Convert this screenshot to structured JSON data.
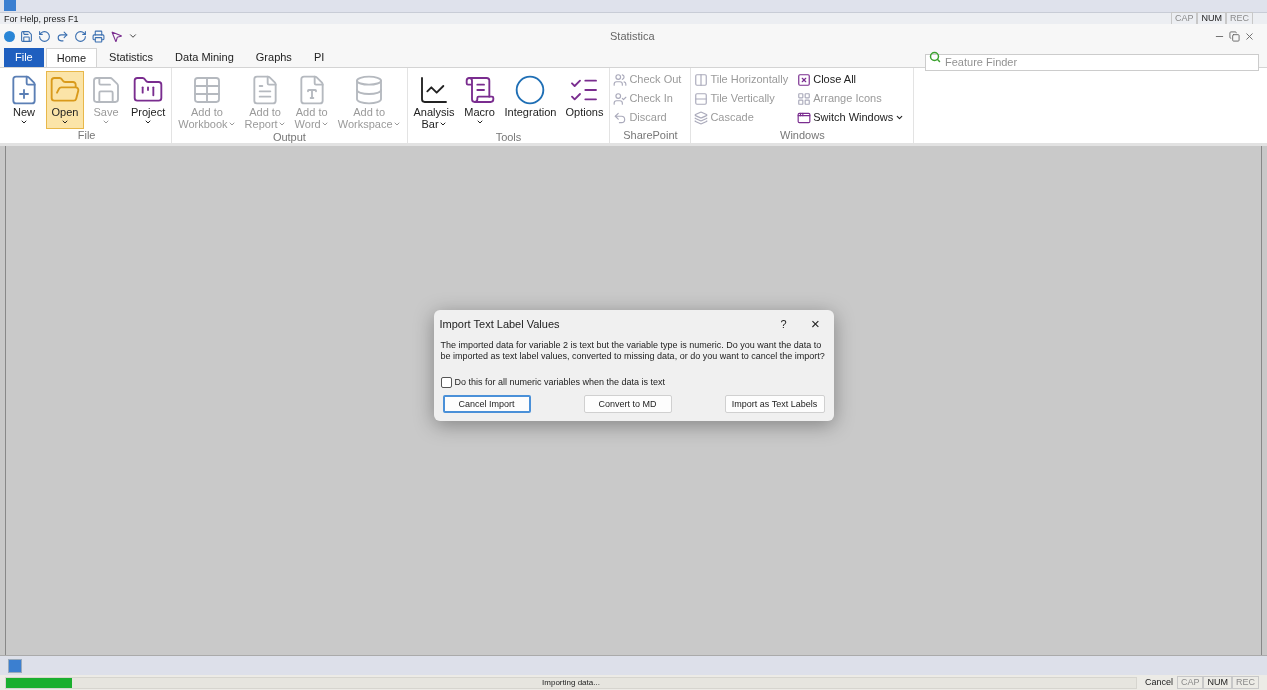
{
  "help_text": "For Help, press F1",
  "top_indicators": [
    {
      "label": "CAP",
      "on": false
    },
    {
      "label": "NUM",
      "on": true
    },
    {
      "label": "REC",
      "on": false
    }
  ],
  "window": {
    "title": "Statistica"
  },
  "tabs": [
    {
      "label": "File",
      "kind": "file",
      "selected": false
    },
    {
      "label": "Home",
      "kind": "tab",
      "selected": true
    },
    {
      "label": "Statistics",
      "kind": "tab",
      "selected": false
    },
    {
      "label": "Data Mining",
      "kind": "tab",
      "selected": false
    },
    {
      "label": "Graphs",
      "kind": "tab",
      "selected": false
    },
    {
      "label": "PI",
      "kind": "tab",
      "selected": false
    }
  ],
  "search": {
    "placeholder": "Feature Finder"
  },
  "ribbon_groups": [
    {
      "label": "File",
      "kind": "large",
      "items": [
        {
          "lines": [
            "New"
          ],
          "dropdown": true,
          "disabled": false,
          "selected": false
        },
        {
          "lines": [
            "Open"
          ],
          "dropdown": true,
          "disabled": false,
          "selected": true
        },
        {
          "lines": [
            "Save"
          ],
          "dropdown": true,
          "disabled": true,
          "selected": false
        },
        {
          "lines": [
            "Project"
          ],
          "dropdown": true,
          "disabled": false,
          "selected": false
        }
      ]
    },
    {
      "label": "Output",
      "kind": "large",
      "items": [
        {
          "lines": [
            "Add to",
            "Workbook"
          ],
          "dropdown": true,
          "disabled": true,
          "selected": false
        },
        {
          "lines": [
            "Add to",
            "Report"
          ],
          "dropdown": true,
          "disabled": true,
          "selected": false
        },
        {
          "lines": [
            "Add to",
            "Word"
          ],
          "dropdown": true,
          "disabled": true,
          "selected": false
        },
        {
          "lines": [
            "Add to",
            "Workspace"
          ],
          "dropdown": true,
          "disabled": true,
          "selected": false
        }
      ]
    },
    {
      "label": "Tools",
      "kind": "large",
      "items": [
        {
          "lines": [
            "Analysis",
            "Bar"
          ],
          "dropdown": true,
          "disabled": false,
          "selected": false
        },
        {
          "lines": [
            "Macro"
          ],
          "dropdown": true,
          "disabled": false,
          "selected": false
        },
        {
          "lines": [
            "Integration"
          ],
          "dropdown": false,
          "disabled": false,
          "selected": false
        },
        {
          "lines": [
            "Options"
          ],
          "dropdown": false,
          "disabled": false,
          "selected": false
        }
      ]
    },
    {
      "label": "SharePoint",
      "kind": "small",
      "columns": [
        [
          {
            "label": "Check Out",
            "disabled": true,
            "dropdown": false
          },
          {
            "label": "Check In",
            "disabled": true,
            "dropdown": false
          },
          {
            "label": "Discard",
            "disabled": true,
            "dropdown": false
          }
        ]
      ]
    },
    {
      "label": "Windows",
      "kind": "small",
      "columns": [
        [
          {
            "label": "Tile Horizontally",
            "disabled": true,
            "dropdown": false
          },
          {
            "label": "Tile Vertically",
            "disabled": true,
            "dropdown": false
          },
          {
            "label": "Cascade",
            "disabled": true,
            "dropdown": false
          }
        ],
        [
          {
            "label": "Close All",
            "disabled": false,
            "dropdown": false
          },
          {
            "label": "Arrange Icons",
            "disabled": true,
            "dropdown": false
          },
          {
            "label": "Switch Windows",
            "disabled": false,
            "dropdown": true
          }
        ]
      ]
    }
  ],
  "dialog": {
    "title": "Import Text Label Values",
    "help": "?",
    "close": "×",
    "message": "The imported data for variable 2 is text but the variable type is numeric.  Do you want the data to be imported as text label values, converted to missing data, or do you want to cancel the import?",
    "checkbox": {
      "label": "Do this for all numeric variables when the data is text",
      "checked": false
    },
    "buttons": [
      {
        "label": "Cancel Import",
        "default": true
      },
      {
        "label": "Convert to MD",
        "default": false
      },
      {
        "label": "Import as Text Labels",
        "default": false
      }
    ]
  },
  "status_bar": {
    "progress": {
      "level": 0.058,
      "text": "Importing data..."
    },
    "cancel": "Cancel",
    "indicators": [
      {
        "label": "CAP",
        "on": false
      },
      {
        "label": "NUM",
        "on": true
      },
      {
        "label": "REC",
        "on": false
      }
    ]
  }
}
